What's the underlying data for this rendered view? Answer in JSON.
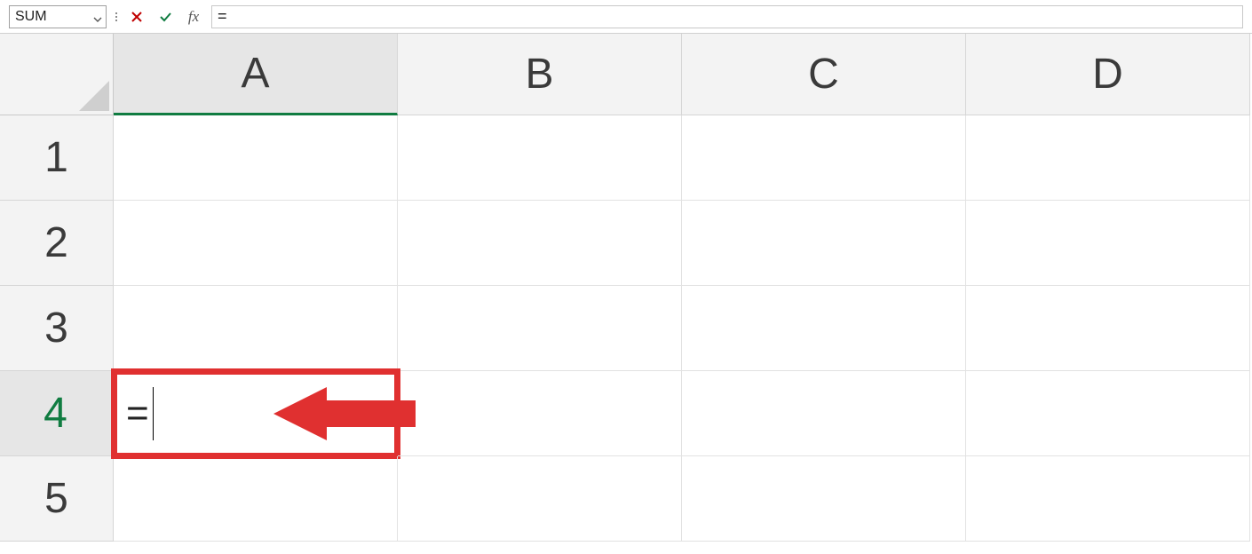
{
  "name_box": {
    "value": "SUM"
  },
  "formula_bar": {
    "value": "="
  },
  "columns": [
    "A",
    "B",
    "C",
    "D"
  ],
  "rows": [
    "1",
    "2",
    "3",
    "4",
    "5"
  ],
  "active": {
    "col": "A",
    "row": "4"
  },
  "cells": {
    "A4": "="
  },
  "icons": {
    "cancel": "✕",
    "enter": "✓",
    "fx": "fx"
  },
  "annotation": {
    "type": "arrow-left",
    "target": "A4",
    "color": "#e03030"
  }
}
